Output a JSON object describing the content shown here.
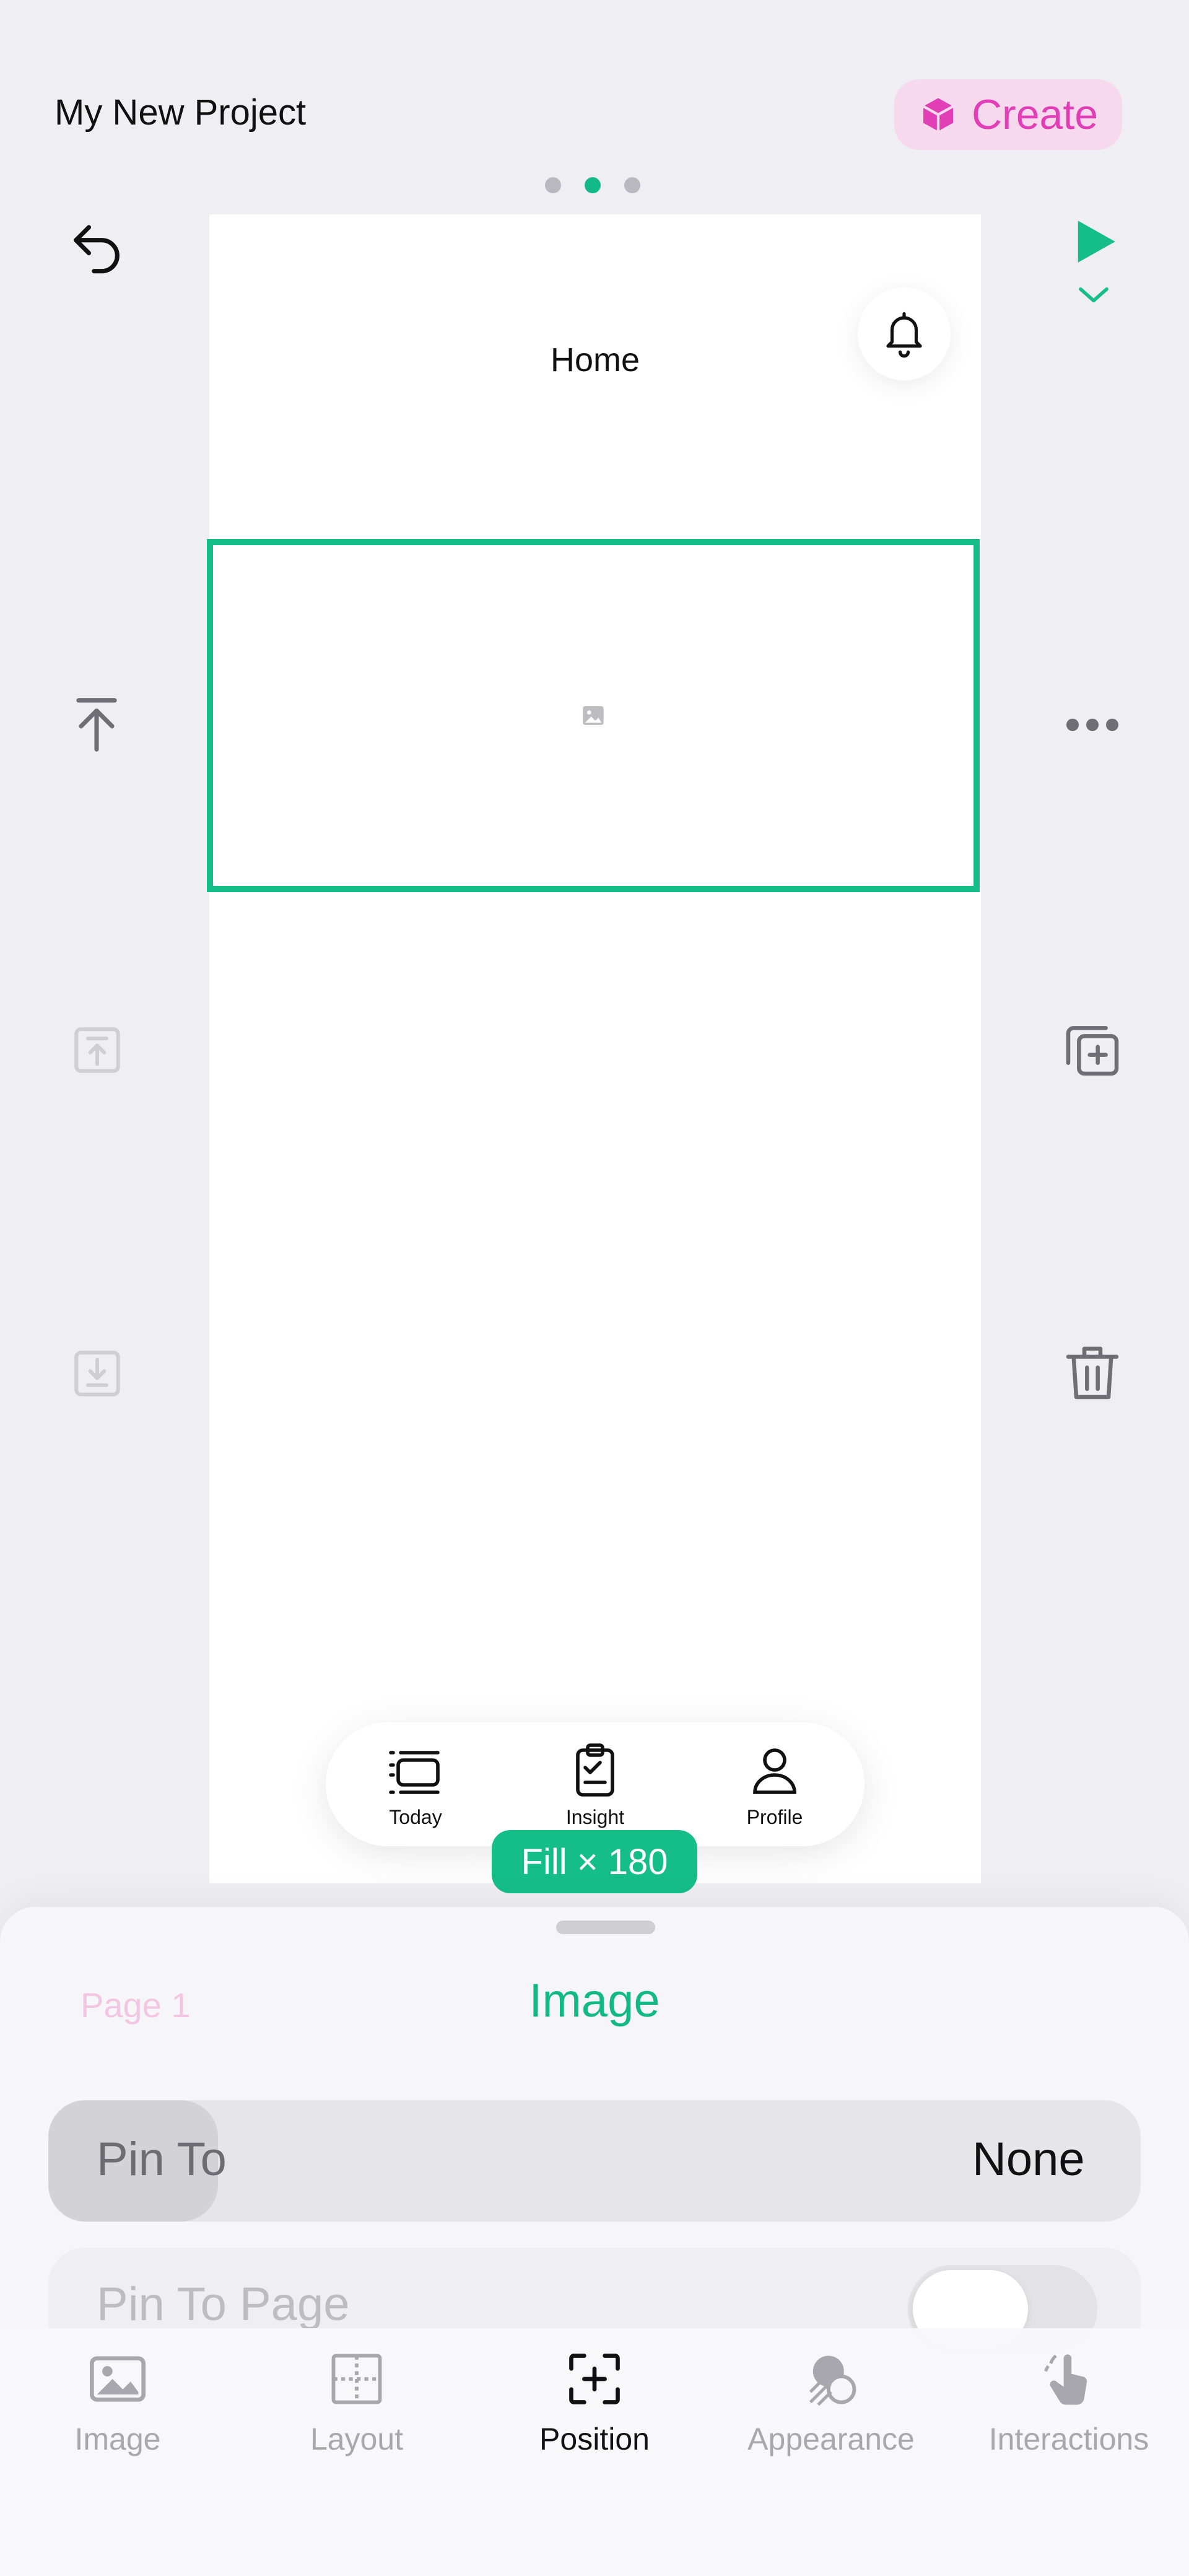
{
  "header": {
    "project_title": "My New Project",
    "create_label": "Create"
  },
  "pager": {
    "count": 3,
    "active_index": 1
  },
  "canvas": {
    "title": "Home",
    "badge": "Fill × 180",
    "tabs": [
      {
        "label": "Today",
        "icon": "today-icon"
      },
      {
        "label": "Insight",
        "icon": "clipboard-icon"
      },
      {
        "label": "Profile",
        "icon": "profile-icon"
      }
    ]
  },
  "sheet": {
    "page_link": "Page 1",
    "title": "Image",
    "pin_to": {
      "label": "Pin To",
      "value": "None"
    },
    "pin_to_page": {
      "label": "Pin To Page",
      "enabled": false
    }
  },
  "toolbar": {
    "tabs": [
      {
        "label": "Image",
        "icon": "image-icon"
      },
      {
        "label": "Layout",
        "icon": "layout-icon"
      },
      {
        "label": "Position",
        "icon": "position-icon",
        "active": true
      },
      {
        "label": "Appearance",
        "icon": "appearance-icon"
      },
      {
        "label": "Interactions",
        "icon": "interactions-icon"
      }
    ]
  },
  "colors": {
    "accent_green": "#16be87",
    "create_pink": "#e23fb6",
    "create_bg": "#f7d9ee"
  }
}
